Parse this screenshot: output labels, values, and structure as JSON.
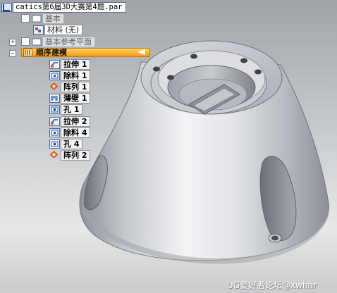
{
  "tree": {
    "file_name": "catics第6届3D大赛第4题.par",
    "base": "基本",
    "material": "材料 (无)",
    "base_ref_planes": "基本参考平面",
    "sequential_modeling": "顺序建模",
    "features": [
      {
        "label": "拉伸 1",
        "icon": "extrude-icon"
      },
      {
        "label": "除料 1",
        "icon": "cutout-icon"
      },
      {
        "label": "阵列 1",
        "icon": "pattern-icon"
      },
      {
        "label": "薄壁 1",
        "icon": "thinwall-icon"
      },
      {
        "label": "孔 1",
        "icon": "hole-icon"
      },
      {
        "label": "拉伸 2",
        "icon": "extrude-icon"
      },
      {
        "label": "除料 4",
        "icon": "cutout-icon"
      },
      {
        "label": "孔 4",
        "icon": "hole-icon"
      },
      {
        "label": "阵列 2",
        "icon": "pattern-icon"
      }
    ]
  },
  "watermark": "UG爱好者论坛@xwhhr",
  "colors": {
    "highlight": "#ffb42f",
    "part_shade": "#b9bcc2",
    "background_top": "#9fa4a9",
    "background_bottom": "#e6e7e8"
  }
}
